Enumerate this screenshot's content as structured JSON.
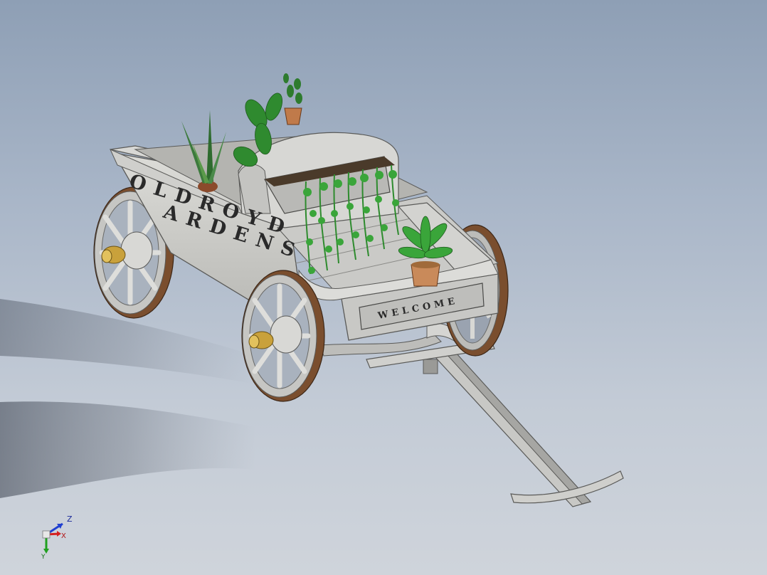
{
  "model": {
    "name": "Oldroyd Gardens garden wagon",
    "side_lettering_line1": "OLDROYD",
    "side_lettering_line2": "ARDENS",
    "back_sign": "WELCOME"
  },
  "triad": {
    "z_label": "Z",
    "x_label": "X",
    "y_label": "Y"
  },
  "colors": {
    "background_top": "#8e9fb5",
    "background_bottom": "#cfd4db",
    "body": "#c9c9c6",
    "body_shade": "#a9a9a6",
    "wheel_rim": "#7a4e2e",
    "hub_brass": "#c9a13b",
    "foliage": "#2e8b2e",
    "pot": "#c98a5a",
    "triad_x": "#d42020",
    "triad_y": "#20a020",
    "triad_z": "#2040d0"
  }
}
